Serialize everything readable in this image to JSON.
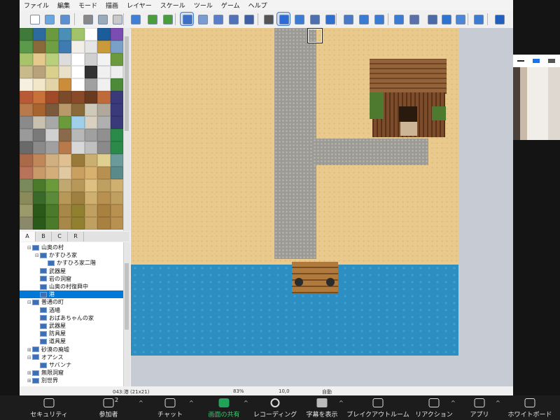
{
  "menu": [
    "ファイル",
    "編集",
    "モード",
    "描画",
    "レイヤー",
    "スケール",
    "ツール",
    "ゲーム",
    "ヘルプ"
  ],
  "tileset_tabs": [
    "A",
    "B",
    "C",
    "R"
  ],
  "active_tab": "A",
  "map_tree": [
    {
      "label": "山奥の村",
      "indent": 1,
      "toggle": "⊟"
    },
    {
      "label": "かすひろ家",
      "indent": 2,
      "toggle": "⊟"
    },
    {
      "label": "かすひろ家二階",
      "indent": 3,
      "toggle": ""
    },
    {
      "label": "武器屋",
      "indent": 2,
      "toggle": ""
    },
    {
      "label": "岩の洞窟",
      "indent": 2,
      "toggle": ""
    },
    {
      "label": "山奥の村復興中",
      "indent": 2,
      "toggle": ""
    },
    {
      "label": "港",
      "indent": 2,
      "toggle": "",
      "selected": true
    },
    {
      "label": "普通の町",
      "indent": 1,
      "toggle": "⊟"
    },
    {
      "label": "酒場",
      "indent": 2,
      "toggle": ""
    },
    {
      "label": "おばあちゃんの家",
      "indent": 2,
      "toggle": ""
    },
    {
      "label": "武器屋",
      "indent": 2,
      "toggle": ""
    },
    {
      "label": "防具屋",
      "indent": 2,
      "toggle": ""
    },
    {
      "label": "道具屋",
      "indent": 2,
      "toggle": ""
    },
    {
      "label": "砂漠の廃墟",
      "indent": 1,
      "toggle": "⊞"
    },
    {
      "label": "オアシス",
      "indent": 1,
      "toggle": "⊟"
    },
    {
      "label": "サバンナ",
      "indent": 2,
      "toggle": ""
    },
    {
      "label": "無限洞窟",
      "indent": 1,
      "toggle": "⊞"
    },
    {
      "label": "別世界",
      "indent": 1,
      "toggle": "⊞"
    }
  ],
  "status": {
    "map": "043:港 (21x21)",
    "zoom": "83%",
    "coords": "10,0",
    "mode": "自動"
  },
  "meeting": [
    {
      "label": "セキュリティ",
      "icon": "shield-icon",
      "badge": ""
    },
    {
      "label": "参加者",
      "icon": "participants-icon",
      "badge": "2"
    },
    {
      "label": "チャット",
      "icon": "chat-icon",
      "badge": ""
    },
    {
      "label": "画面の共有",
      "icon": "share-screen-icon",
      "badge": ""
    },
    {
      "label": "レコーディング",
      "icon": "record-icon",
      "badge": ""
    },
    {
      "label": "字幕を表示",
      "icon": "captions-icon",
      "badge": ""
    },
    {
      "label": "ブレイクアウトルーム",
      "icon": "breakout-icon",
      "badge": ""
    },
    {
      "label": "リアクション",
      "icon": "reaction-icon",
      "badge": ""
    },
    {
      "label": "アプリ",
      "icon": "apps-icon",
      "badge": ""
    },
    {
      "label": "ホワイトボード",
      "icon": "whiteboard-icon",
      "badge": ""
    }
  ],
  "colors": {
    "accent": "#0078d7",
    "share_green": "#21a45a",
    "sand": "#e9c98c",
    "water": "#2d8ec2",
    "road": "#9b9a95"
  }
}
